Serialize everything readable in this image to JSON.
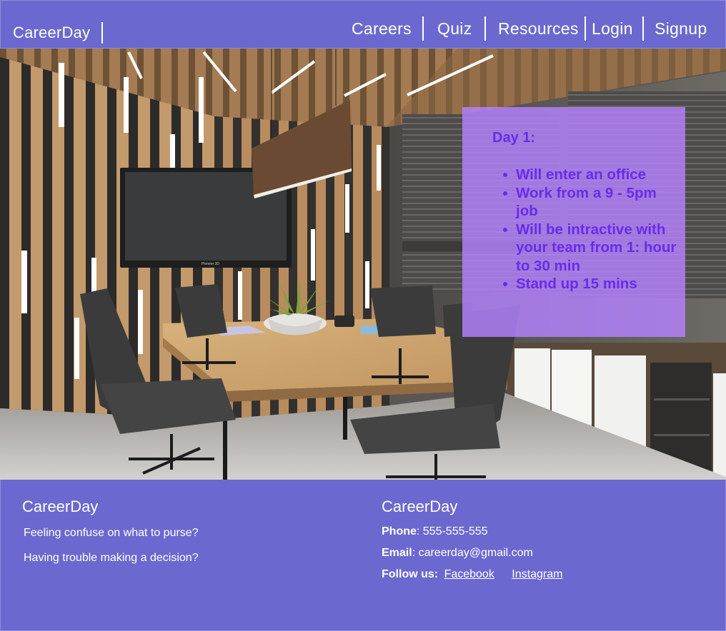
{
  "nav": {
    "brand": "CareerDay",
    "links": [
      "Careers",
      "Quiz",
      "Resources",
      "Login",
      "Signup"
    ]
  },
  "hero": {
    "image": "modern-meeting-room-photo",
    "tv_brand": "Pioneer 3D"
  },
  "info_card": {
    "title": "Day 1:",
    "items": [
      "Will enter an office",
      "Work from a 9 - 5pm job",
      "Will be intractive with your team from 1: hour to 30 min",
      "Stand up 15 mins"
    ]
  },
  "footer": {
    "left": {
      "brand": "CareerDay",
      "line1": "Feeling confuse on what to purse?",
      "line2": "Having trouble making a decision?"
    },
    "right": {
      "brand": "CareerDay",
      "phone_label": "Phone",
      "phone": ": 555-555-555",
      "email_label": "Email",
      "email": ": careerday@gmail.com",
      "follow_label": "Follow us:",
      "links": [
        "Facebook",
        "Instagram"
      ]
    }
  },
  "colors": {
    "nav_bg": "#6b69cf",
    "card_bg": "#b482ff",
    "card_text": "#6a2bea"
  }
}
